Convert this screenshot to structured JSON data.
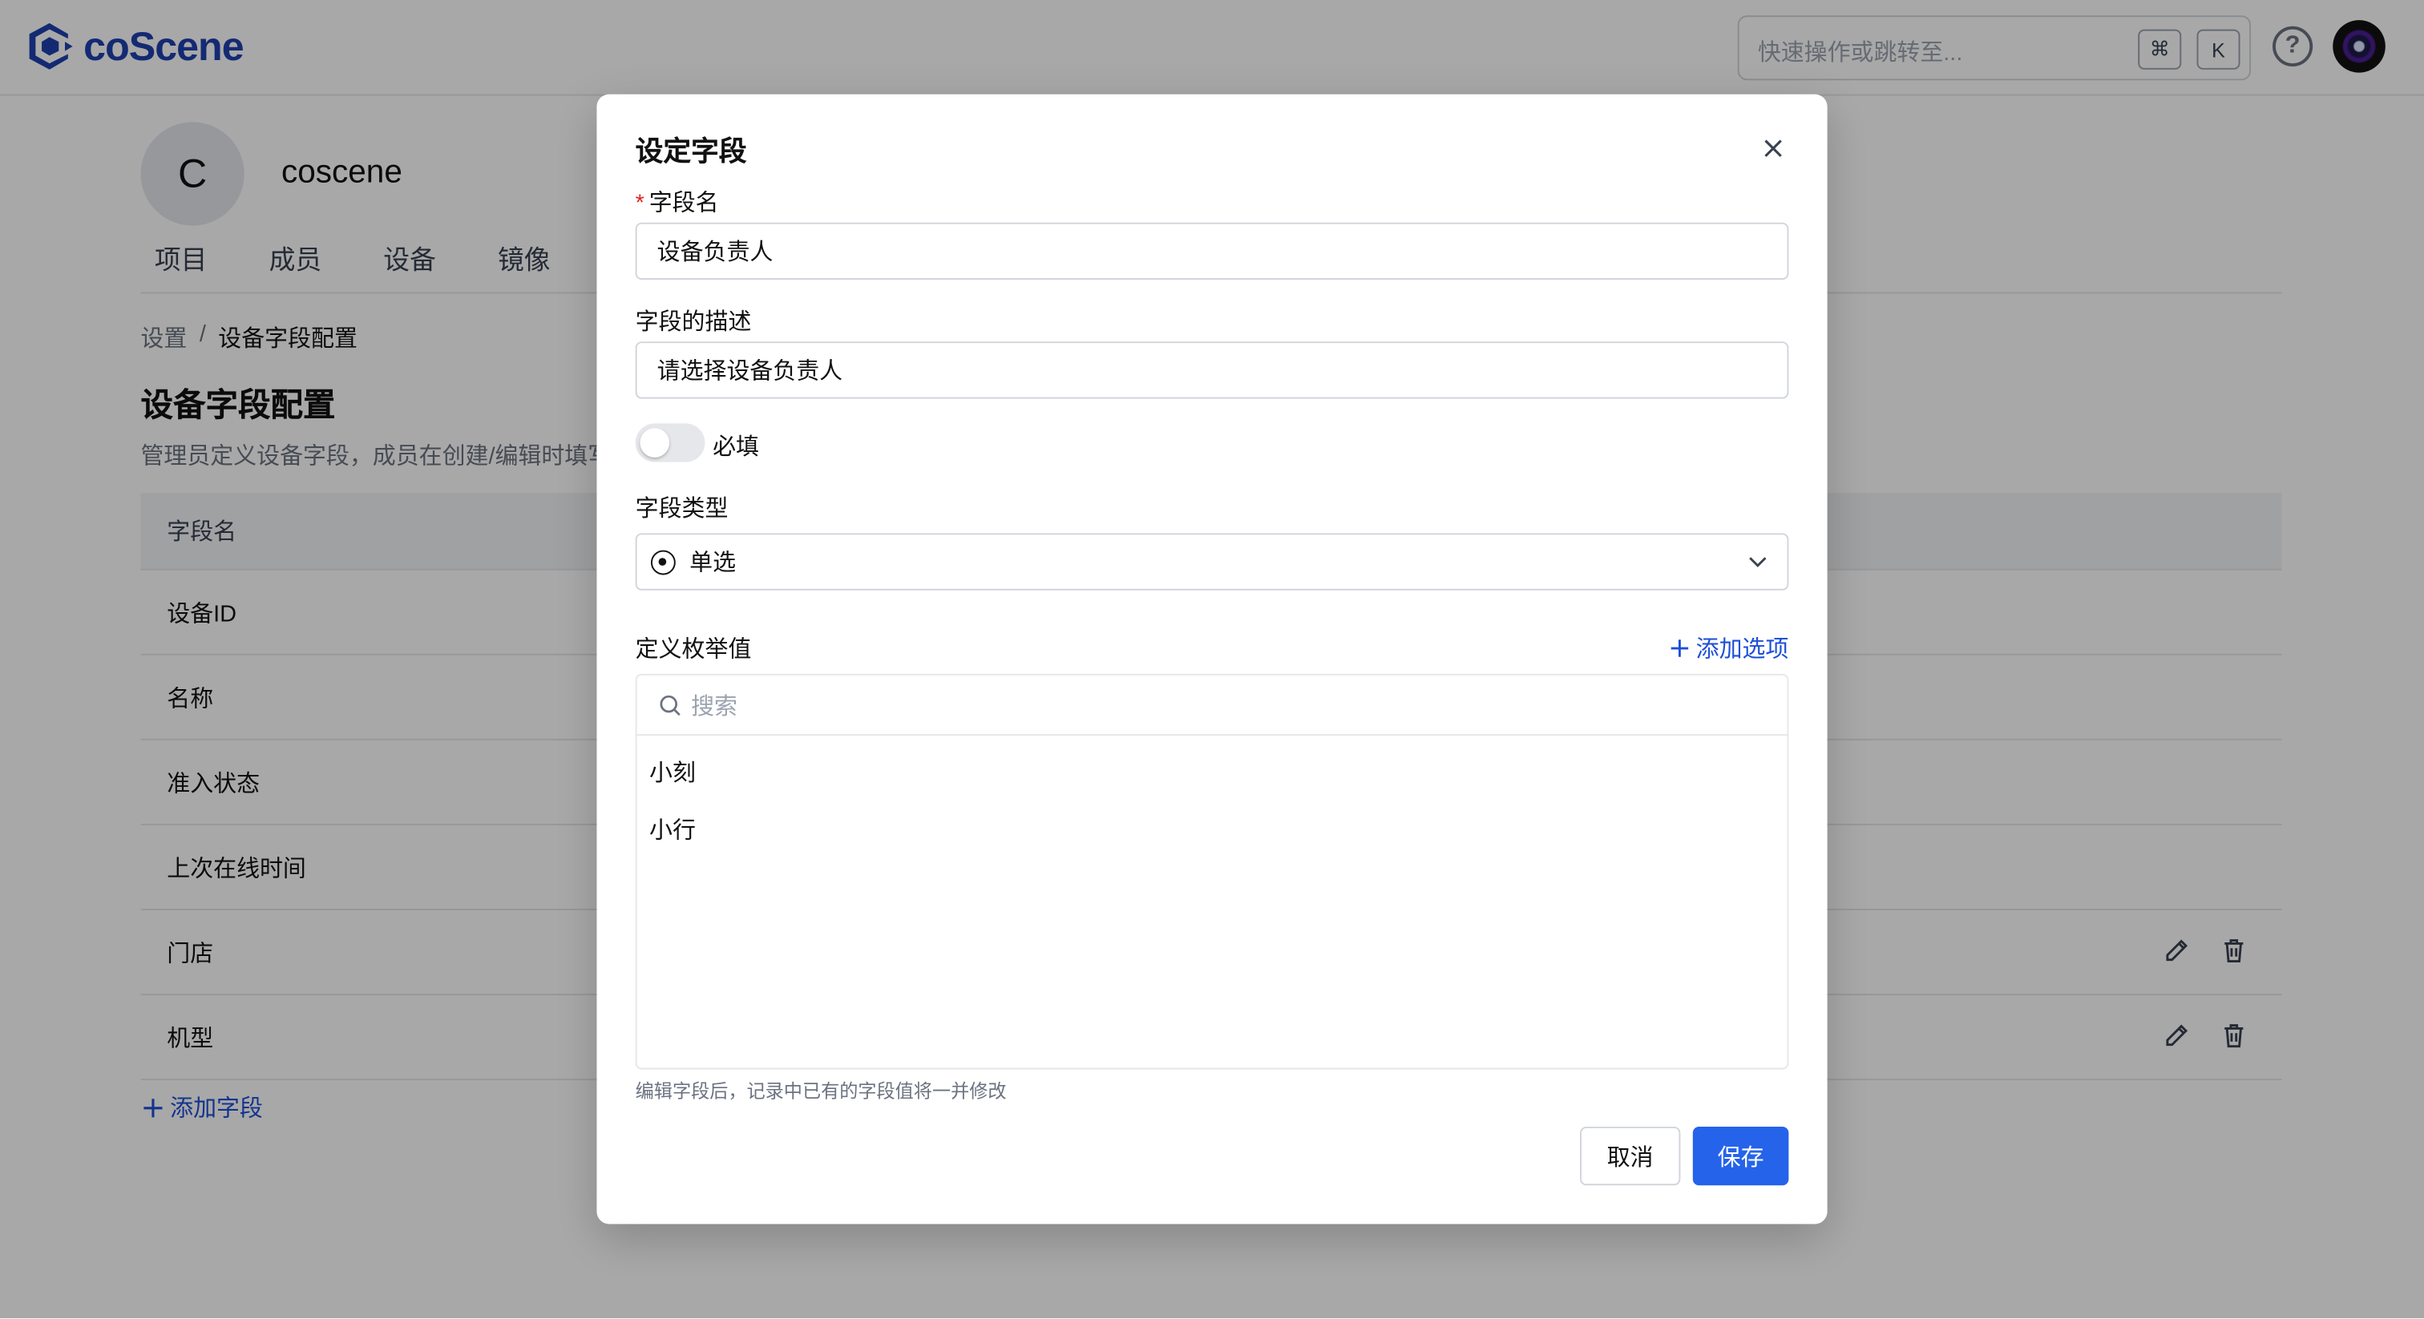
{
  "app": {
    "logo_text": "coScene",
    "search_placeholder": "快速操作或跳转至...",
    "shortcut_cmd": "⌘",
    "shortcut_key": "K",
    "help_glyph": "?"
  },
  "org": {
    "avatar_letter": "C",
    "name": "coscene",
    "tabs": [
      "项目",
      "成员",
      "设备",
      "镜像"
    ]
  },
  "breadcrumb": {
    "parent": "设置",
    "separator": "/",
    "current": "设备字段配置"
  },
  "page": {
    "title": "设备字段配置",
    "description": "管理员定义设备字段，成员在创建/编辑时填写"
  },
  "table": {
    "header": "字段名",
    "rows": [
      "设备ID",
      "名称",
      "准入状态",
      "上次在线时间",
      "门店",
      "机型"
    ]
  },
  "add_field_label": "添加字段",
  "modal": {
    "title": "设定字段",
    "field_name_label": "字段名",
    "field_name_value": "设备负责人",
    "field_desc_label": "字段的描述",
    "field_desc_value": "请选择设备负责人",
    "required_label": "必填",
    "required_on": false,
    "type_label": "字段类型",
    "type_value": "单选",
    "enum_label": "定义枚举值",
    "add_option_label": "添加选项",
    "enum_search_placeholder": "搜索",
    "enum_items": [
      "小刻",
      "小行"
    ],
    "hint": "编辑字段后，记录中已有的字段值将一并修改",
    "cancel_label": "取消",
    "save_label": "保存"
  },
  "colors": {
    "brand": "#1e40af",
    "primary": "#2563eb",
    "danger": "#dc2626",
    "overlay": "rgba(0,0,0,0.34)"
  }
}
